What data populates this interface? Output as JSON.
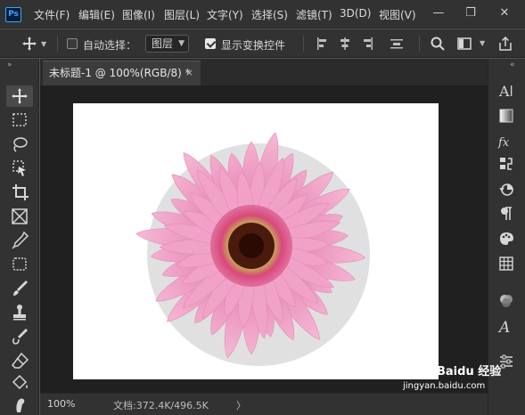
{
  "app": {
    "logo_text": "Ps",
    "menu": [
      "文件(F)",
      "编辑(E)",
      "图像(I)",
      "图层(L)",
      "文字(Y)",
      "选择(S)",
      "滤镜(T)",
      "3D(D)",
      "视图(V)"
    ],
    "window_controls": {
      "minimize": "—",
      "maximize": "❐",
      "close": "✕"
    }
  },
  "options": {
    "auto_select_label": "自动选择：",
    "auto_select_checked": false,
    "target_value": "图层",
    "show_transform_label": "显示变换控件",
    "show_transform_checked": true
  },
  "document": {
    "tab_title": "未标题-1 @ 100%(RGB/8) *",
    "close_glyph": "×"
  },
  "status": {
    "zoom": "100%",
    "doc_size": "文档:372.4K/496.5K",
    "arrow": "〉"
  },
  "panel": {
    "collapse_left": "»",
    "collapse_right": "«"
  },
  "watermark": {
    "brand": "Baidu 经验",
    "url": "jingyan.baidu.com"
  },
  "colors": {
    "ui_bg": "#323232",
    "canvas_bg": "#202020",
    "accent": "#31a8ff",
    "petal": "#f2a3c8",
    "petal_dark": "#e57fb0",
    "flower_center": "#5a2a1a"
  }
}
